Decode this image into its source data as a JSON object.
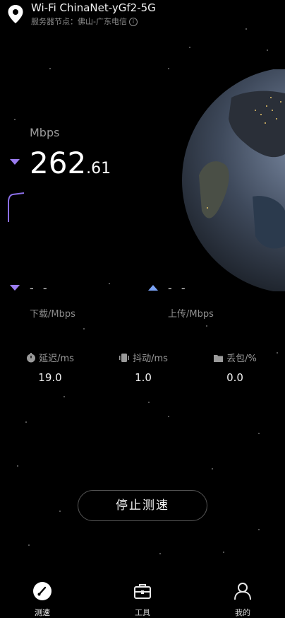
{
  "header": {
    "wifi_title": "Wi-Fi ChinaNet-yGf2-5G",
    "server_label": "服务器节点：佛山-广东电信"
  },
  "live": {
    "unit": "Mbps",
    "speed_int": "262",
    "speed_dec": ".61"
  },
  "download": {
    "value": "- -",
    "label": "下载/Mbps"
  },
  "upload": {
    "value": "- -",
    "label": "上传/Mbps"
  },
  "metrics": [
    {
      "label": "延迟/ms",
      "value": "19.0",
      "icon": "timer-icon"
    },
    {
      "label": "抖动/ms",
      "value": "1.0",
      "icon": "vibrate-icon"
    },
    {
      "label": "丢包/%",
      "value": "0.0",
      "icon": "folder-icon"
    }
  ],
  "stop_button": "停止测速",
  "nav": [
    {
      "label": "测速",
      "icon": "speedometer-icon",
      "active": true
    },
    {
      "label": "工具",
      "icon": "toolbox-icon",
      "active": false
    },
    {
      "label": "我的",
      "icon": "person-icon",
      "active": false
    }
  ],
  "colors": {
    "download_accent": "#9b7cf0",
    "upload_accent": "#7aa2f5",
    "background": "#000000"
  }
}
